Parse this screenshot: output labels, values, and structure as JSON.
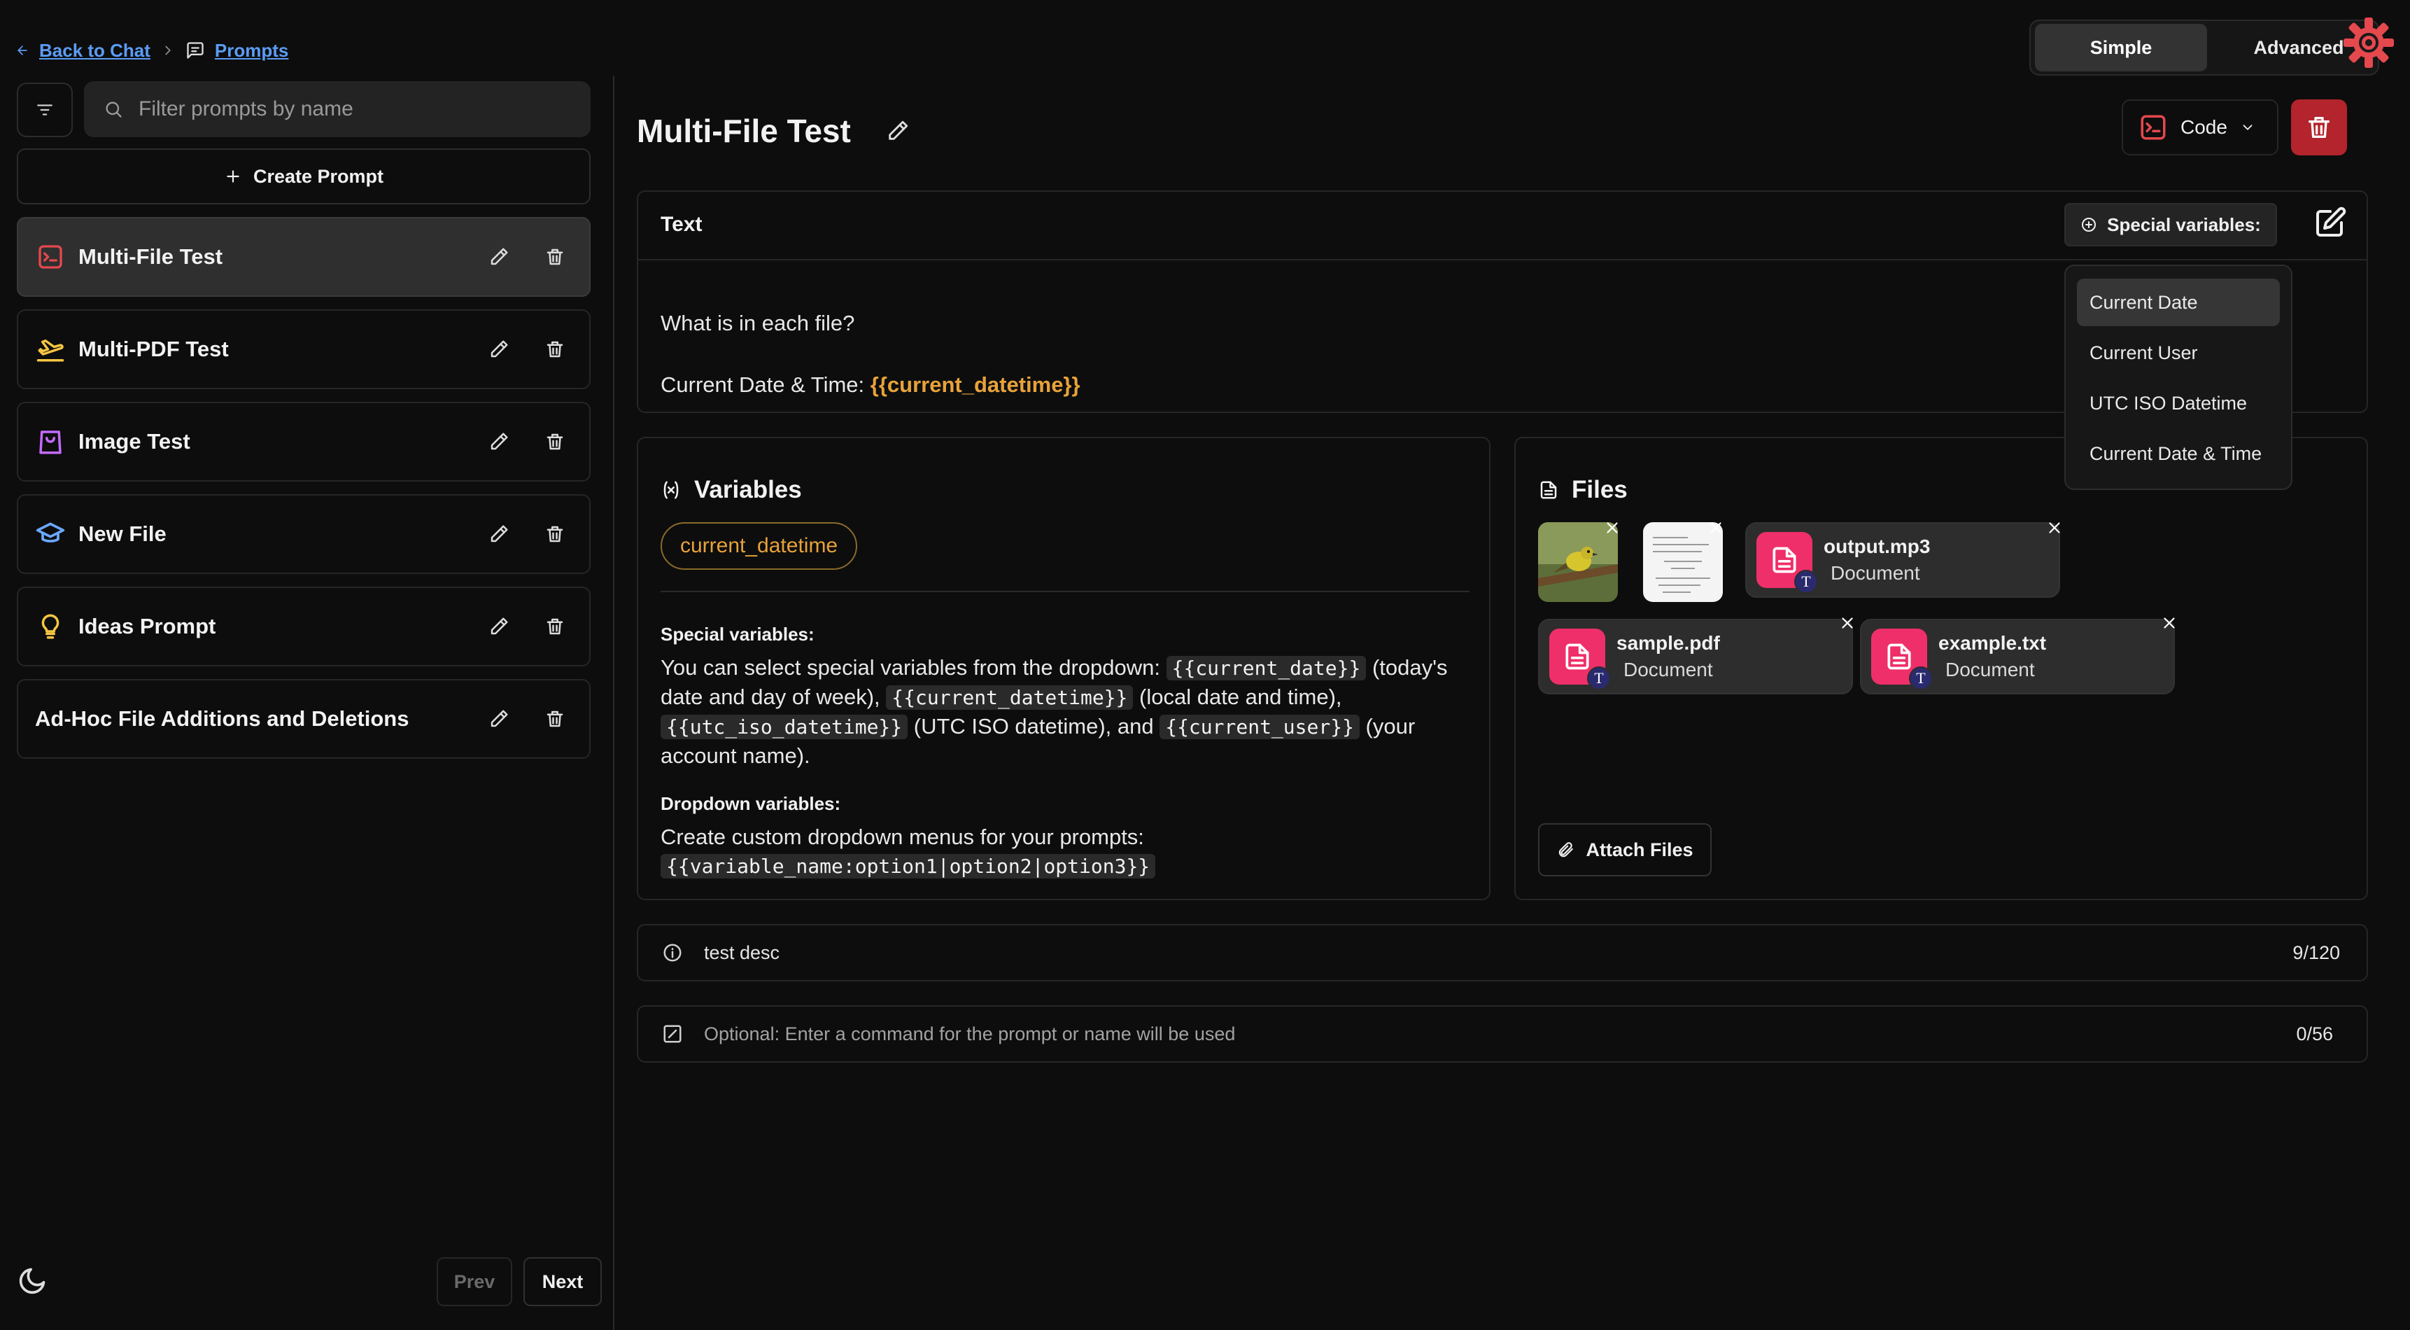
{
  "breadcrumb": {
    "back_label": "Back to Chat",
    "prompts_label": "Prompts"
  },
  "mode": {
    "simple_label": "Simple",
    "advanced_label": "Advanced"
  },
  "sidebar": {
    "search_placeholder": "Filter prompts by name",
    "create_label": "Create Prompt",
    "items": [
      {
        "name": "Multi-File Test",
        "icon": "terminal-icon",
        "color": "#e5484d",
        "active": true
      },
      {
        "name": "Multi-PDF Test",
        "icon": "airplane-icon",
        "color": "#f5c542"
      },
      {
        "name": "Image Test",
        "icon": "shopping-bag-icon",
        "color": "#c46bff"
      },
      {
        "name": "New File",
        "icon": "graduation-cap-icon",
        "color": "#6aa8ff"
      },
      {
        "name": "Ideas Prompt",
        "icon": "lightbulb-icon",
        "color": "#f5c542"
      },
      {
        "name": "Ad-Hoc File Additions and Deletions",
        "icon": "",
        "color": ""
      }
    ],
    "prev_label": "Prev",
    "next_label": "Next"
  },
  "header": {
    "title": "Multi-File Test",
    "category_label": "Code"
  },
  "text_panel": {
    "label": "Text",
    "special_vars_label": "Special variables:",
    "line1": "What is in each file?",
    "line2_prefix": "Current Date & Time: ",
    "line2_var": "{{current_datetime}}"
  },
  "dropdown": {
    "items": [
      "Current Date",
      "Current User",
      "UTC ISO Datetime",
      "Current Date & Time"
    ],
    "highlighted": "Current Date"
  },
  "variables": {
    "title": "Variables",
    "chip": "current_datetime",
    "special_heading": "Special variables:",
    "special_t1": "You can select special variables from the dropdown: ",
    "special_c1": "{{current_date}}",
    "special_t2": " (today's date and day of week), ",
    "special_c2": "{{current_datetime}}",
    "special_t3": " (local date and time), ",
    "special_c3": "{{utc_iso_datetime}}",
    "special_t4": " (UTC ISO datetime), and ",
    "special_c4": "{{current_user}}",
    "special_t5": " (your account name).",
    "dropdown_heading": "Dropdown variables:",
    "dropdown_text": "Create custom dropdown menus for your prompts: ",
    "dropdown_code": "{{variable_name:option1|option2|option3}}"
  },
  "files": {
    "title": "Files",
    "docs": [
      {
        "name": "output.mp3",
        "type": "Document"
      },
      {
        "name": "sample.pdf",
        "type": "Document"
      },
      {
        "name": "example.txt",
        "type": "Document"
      }
    ],
    "attach_label": "Attach Files"
  },
  "description": {
    "value": "test desc",
    "count": "9/120"
  },
  "command": {
    "placeholder": "Optional: Enter a command for the prompt or name will be used",
    "count": "0/56"
  },
  "colors": {
    "accent_orange": "#e8a23a",
    "danger": "#b3242c",
    "link": "#5b9cf5",
    "file_icon": "#ef2f6a"
  }
}
